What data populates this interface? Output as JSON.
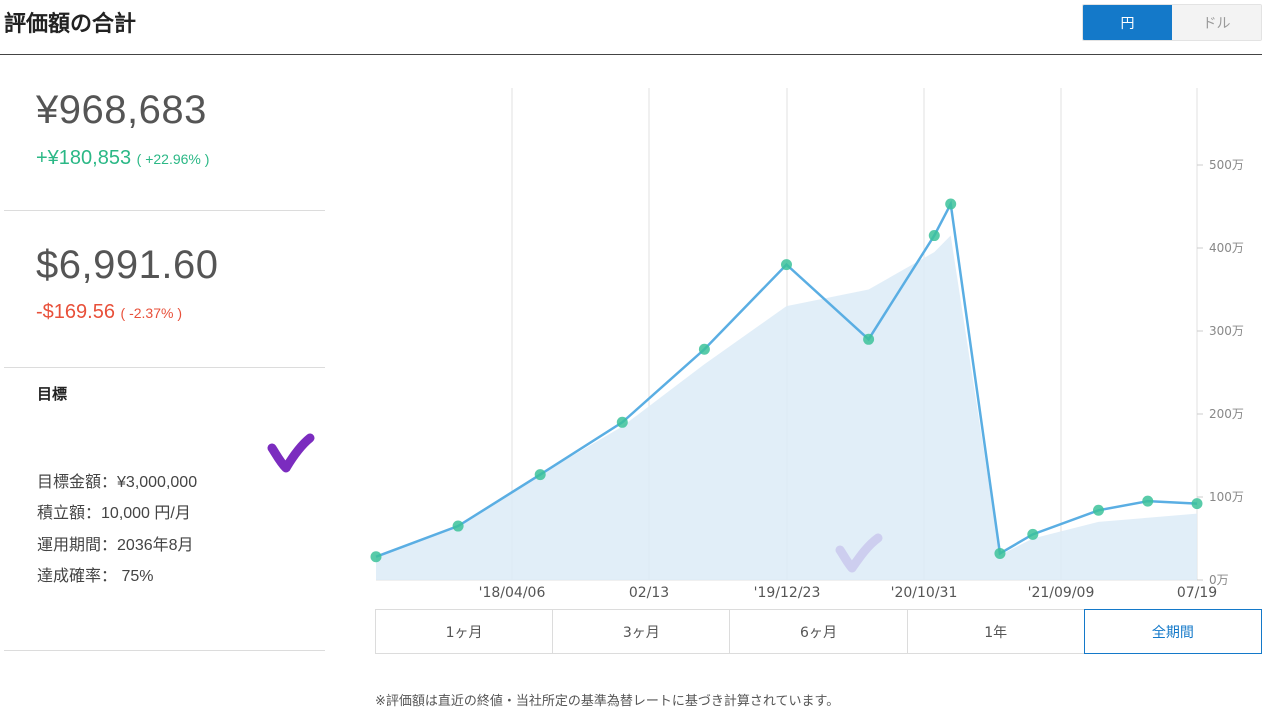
{
  "header": {
    "title": "評価額の合計"
  },
  "currency_toggle": {
    "yen_label": "円",
    "dollar_label": "ドル",
    "selected": "円"
  },
  "summary": {
    "yen_total": "¥968,683",
    "yen_change": "+¥180,853",
    "yen_change_pct": "( +22.96% )",
    "usd_total": "$6,991.60",
    "usd_change": "-$169.56",
    "usd_change_pct": "( -2.37% )"
  },
  "goal": {
    "title": "目標",
    "amount_label": "目標金額：",
    "amount_value": "¥3,000,000",
    "monthly_label": "積立額：",
    "monthly_value": "10,000 円/月",
    "period_label": "運用期間：",
    "period_value": "2036年8月",
    "probability_label": "達成確率：",
    "probability_value": " 75%"
  },
  "ranges": [
    "1ヶ月",
    "3ヶ月",
    "6ヶ月",
    "1年",
    "全期間"
  ],
  "selected_range": "全期間",
  "footnote": "※評価額は直近の終値・当社所定の基準為替レートに基づき計算されています。",
  "colors": {
    "accent": "#1479c9",
    "gain": "#2bb886",
    "loss": "#e8503a",
    "line": "#5aaee3",
    "area": "#dcebf7",
    "marker": "#3cc29a",
    "check": "#7b2cbf"
  },
  "chart_data": {
    "type": "area",
    "x_tick_labels": [
      "'18/04/06",
      "02/13",
      "'19/12/23",
      "'20/10/31",
      "'21/09/09",
      "07/19"
    ],
    "y_tick_labels": [
      "0万",
      "100万",
      "200万",
      "300万",
      "400万",
      "500万"
    ],
    "ylim": [
      0,
      5000000
    ],
    "grid": true,
    "y_axis_position": "right",
    "series": [
      {
        "values_x_index": [
          0,
          0.5,
          1,
          1.5,
          2,
          2.5,
          3,
          3.4,
          3.5,
          3.8,
          4,
          4.4,
          4.7,
          5
        ],
        "values": [
          280000,
          650000,
          1270000,
          1900000,
          2780000,
          3800000,
          2900000,
          4150000,
          4530000,
          320000,
          550000,
          840000,
          950000,
          920000
        ]
      },
      {
        "values_x_index": [
          0,
          0.5,
          1,
          1.5,
          2,
          2.5,
          3,
          3.4,
          3.5,
          3.8,
          4,
          4.4,
          4.7,
          5
        ],
        "values": [
          280000,
          650000,
          1270000,
          1850000,
          2600000,
          3300000,
          3500000,
          3950000,
          4150000,
          300000,
          500000,
          700000,
          750000,
          800000
        ]
      }
    ]
  }
}
